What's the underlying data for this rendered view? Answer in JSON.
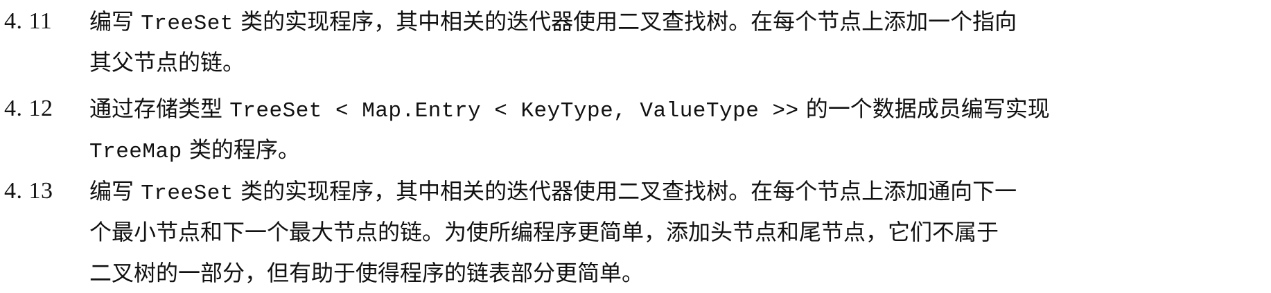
{
  "exercises": [
    {
      "number": "4. 11",
      "lines": [
        [
          {
            "t": "text",
            "v": "编写 "
          },
          {
            "t": "code",
            "v": "TreeSet"
          },
          {
            "t": "text",
            "v": " 类的实现程序，其中相关的迭代器使用二叉查找树。在每个节点上添加一个指向"
          }
        ],
        [
          {
            "t": "text",
            "v": "其父节点的链。"
          }
        ]
      ]
    },
    {
      "number": "4. 12",
      "lines": [
        [
          {
            "t": "text",
            "v": "通过存储类型 "
          },
          {
            "t": "code",
            "v": "TreeSet < Map.Entry < KeyType, ValueType >>"
          },
          {
            "t": "text",
            "v": " 的一个数据成员编写实现"
          }
        ],
        [
          {
            "t": "code",
            "v": "TreeMap"
          },
          {
            "t": "text",
            "v": " 类的程序。"
          }
        ]
      ]
    },
    {
      "number": "4. 13",
      "lines": [
        [
          {
            "t": "text",
            "v": "编写 "
          },
          {
            "t": "code",
            "v": "TreeSet"
          },
          {
            "t": "text",
            "v": " 类的实现程序，其中相关的迭代器使用二叉查找树。在每个节点上添加通向下一"
          }
        ],
        [
          {
            "t": "text",
            "v": "个最小节点和下一个最大节点的链。为使所编程序更简单，添加头节点和尾节点，它们不属于"
          }
        ],
        [
          {
            "t": "text",
            "v": "二叉树的一部分，但有助于使得程序的链表部分更简单。"
          }
        ]
      ]
    }
  ]
}
